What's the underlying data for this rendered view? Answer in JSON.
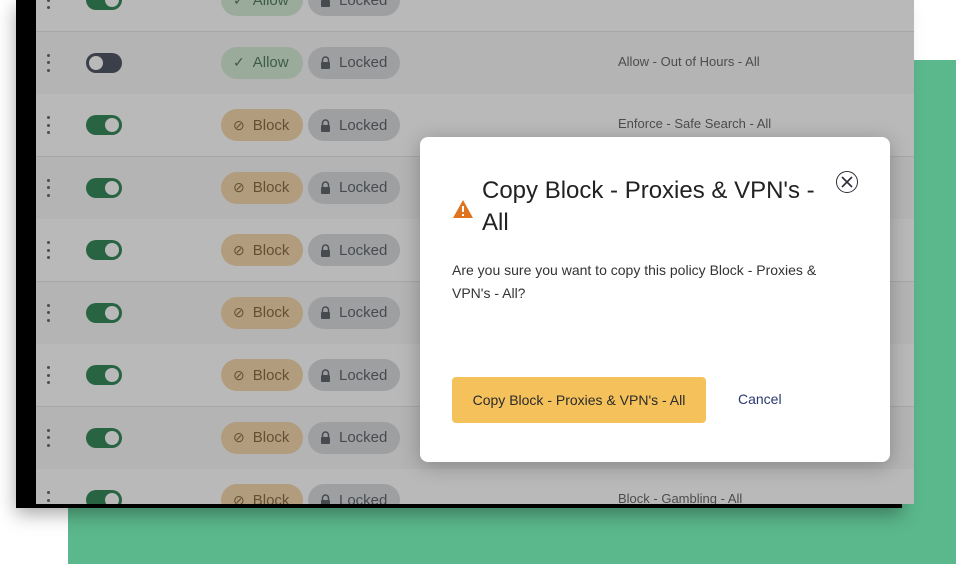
{
  "rows": [
    {
      "enabled": true,
      "action": "Allow",
      "action_type": "allow",
      "lock": "Locked",
      "policy": ""
    },
    {
      "enabled": false,
      "action": "Allow",
      "action_type": "allow",
      "lock": "Locked",
      "policy": "Allow - Out of Hours - All"
    },
    {
      "enabled": true,
      "action": "Block",
      "action_type": "block",
      "lock": "Locked",
      "policy": "Enforce - Safe Search - All"
    },
    {
      "enabled": true,
      "action": "Block",
      "action_type": "block",
      "lock": "Locked",
      "policy": ""
    },
    {
      "enabled": true,
      "action": "Block",
      "action_type": "block",
      "lock": "Locked",
      "policy": ""
    },
    {
      "enabled": true,
      "action": "Block",
      "action_type": "block",
      "lock": "Locked",
      "policy": ""
    },
    {
      "enabled": true,
      "action": "Block",
      "action_type": "block",
      "lock": "Locked",
      "policy": ""
    },
    {
      "enabled": true,
      "action": "Block",
      "action_type": "block",
      "lock": "Locked",
      "policy": ""
    },
    {
      "enabled": true,
      "action": "Block",
      "action_type": "block",
      "lock": "Locked",
      "policy": "Block - Gambling - All"
    }
  ],
  "modal": {
    "title": "Copy Block - Proxies & VPN's - All",
    "message": "Are you sure you want to copy this policy Block - Proxies & VPN's - All?",
    "confirm_label": "Copy Block - Proxies & VPN's - All",
    "cancel_label": "Cancel",
    "warning_icon": "warning-triangle-icon",
    "close_icon": "close-circle-icon"
  },
  "colors": {
    "background_accent": "#5bb88c",
    "toggle_on": "#1e7a45",
    "toggle_off": "#3b4150",
    "block_chip": "#f3d3a2",
    "allow_chip": "#cfe9d2",
    "locked_chip": "#d4d6da",
    "confirm_button": "#f5c15b",
    "warning": "#e0731e"
  }
}
